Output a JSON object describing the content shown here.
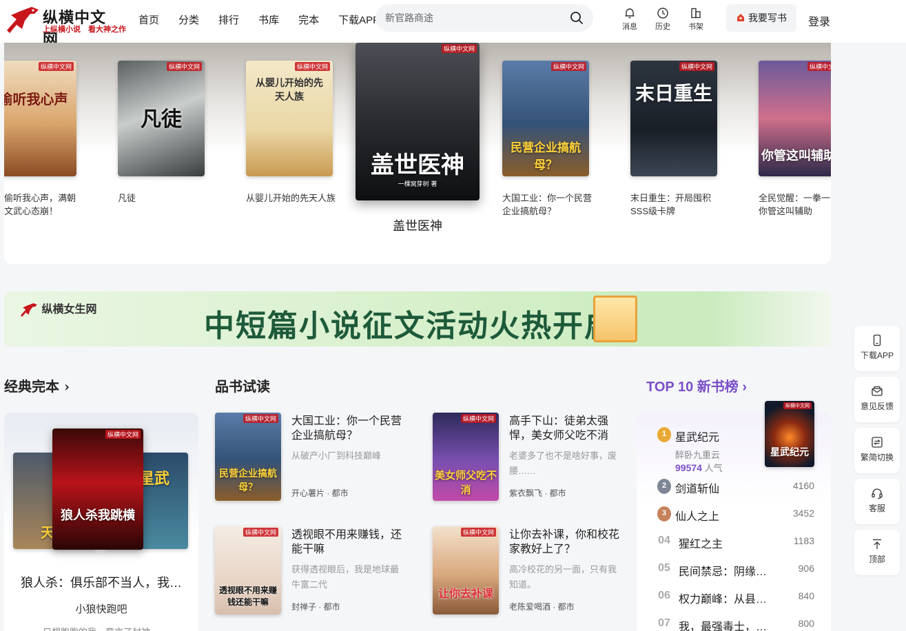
{
  "header": {
    "logo_title": "纵横中文网",
    "logo_sub": "上纵横小说　看大神之作",
    "nav": [
      "首页",
      "分类",
      "排行",
      "书库",
      "完本",
      "下载APP"
    ],
    "search_placeholder": "新官路商途",
    "tools": [
      {
        "label": "消息",
        "icon": "bell-icon"
      },
      {
        "label": "历史",
        "icon": "clock-icon"
      },
      {
        "label": "书架",
        "icon": "bookshelf-icon"
      }
    ],
    "write_label": "我要写书",
    "login_label": "登录"
  },
  "carousel": {
    "books": [
      {
        "title": "偷听我心声，满朝文武心态崩！",
        "cover_text": "偷听我心声"
      },
      {
        "title": "凡徒",
        "cover_text": "凡徒"
      },
      {
        "title": "从婴儿开始的先天人族",
        "cover_text": "从婴儿开始的先天人族"
      },
      {
        "title": "盖世医神",
        "cover_text": "盖世医神",
        "cover_author": "一棵窝芽树 著"
      },
      {
        "title": "大国工业：你一个民营企业搞航母？",
        "cover_text": "民营企业搞航母？"
      },
      {
        "title": "末日重生：开局囤积SSS级卡牌",
        "cover_text": "末日重生"
      },
      {
        "title": "全民觉醒：一拳一个，你管这叫辅助",
        "cover_text": "你管这叫辅助"
      }
    ],
    "cover_badge": "纵横中文网"
  },
  "banner": {
    "logo": "纵横女生网",
    "text": "中短篇小说征文活动火热开启"
  },
  "classic": {
    "section_title": "经典完本",
    "title": "狼人杀：俱乐部不当人，我跳横",
    "author": "小狼快跑吧",
    "intro": "只想跑跑的我，竟言了封神",
    "covers": [
      "天才",
      "狼人杀我跳横",
      "龍星武"
    ]
  },
  "trial": {
    "section_title": "品书试读",
    "books": [
      {
        "title": "大国工业：你一个民营企业搞航母？",
        "desc": "从破产小厂到科技巅峰",
        "meta": "开心薯片 · 都市",
        "cover_text": "民营企业搞航母？"
      },
      {
        "title": "高手下山：徒弟太强悍，美女师父吃不消",
        "desc": "老婆多了也不是啥好事，废腰……",
        "meta": "紫衣飘飞 · 都市",
        "cover_text": "美女师父吃不消"
      },
      {
        "title": "透视眼不用来赚钱，还能干嘛",
        "desc": "获得透视眼后，我是地球最牛富二代",
        "meta": "封禅子 · 都市",
        "cover_text": "透视眼不用来赚钱还能干嘛"
      },
      {
        "title": "让你去补课，你和校花家教好上了？",
        "desc": "高冷校花的另一面，只有我知道。",
        "meta": "老陈爱喝酒 · 都市",
        "cover_text": "让你去补课"
      }
    ]
  },
  "top10": {
    "section_title": "TOP 10 新书榜",
    "first_author": "醉卧九重云",
    "first_value": "99574",
    "first_value_unit": "人气",
    "first_cover_text": "星武纪元",
    "items": [
      {
        "rank": "1",
        "name": "星武纪元",
        "value": ""
      },
      {
        "rank": "2",
        "name": "剑道斩仙",
        "value": "4160"
      },
      {
        "rank": "3",
        "name": "仙人之上",
        "value": "3452"
      },
      {
        "rank": "04",
        "name": "猩红之主",
        "value": "1183"
      },
      {
        "rank": "05",
        "name": "民间禁忌：阴缘…",
        "value": "906"
      },
      {
        "rank": "06",
        "name": "权力巅峰：从县…",
        "value": "840"
      },
      {
        "rank": "07",
        "name": "我，最强毒士，…",
        "value": "800"
      }
    ]
  },
  "side": [
    {
      "label": "下载APP",
      "icon": "phone-icon"
    },
    {
      "label": "意见反馈",
      "icon": "mail-icon"
    },
    {
      "label": "繁简切换",
      "icon": "switch-icon"
    },
    {
      "label": "客服",
      "icon": "headset-icon"
    },
    {
      "label": "顶部",
      "icon": "arrow-up-icon"
    }
  ]
}
